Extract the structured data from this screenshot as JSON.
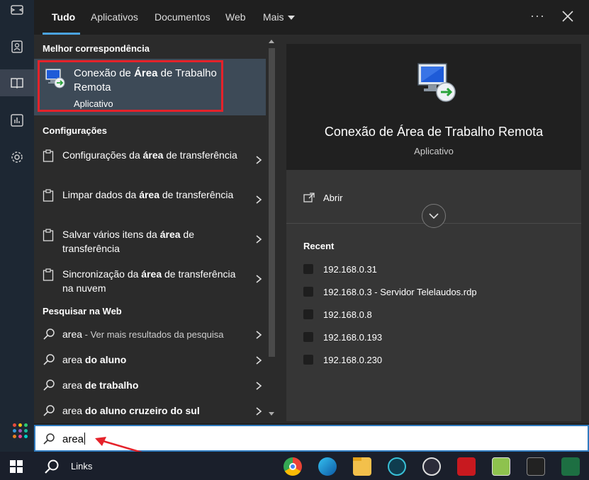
{
  "tabs": [
    {
      "label": "Tudo",
      "active": true
    },
    {
      "label": "Aplicativos"
    },
    {
      "label": "Documentos"
    },
    {
      "label": "Web"
    },
    {
      "label": "Mais"
    }
  ],
  "top_actions": {
    "more": "···"
  },
  "sections": {
    "best_match": "Melhor correspondência",
    "settings": "Configurações",
    "web_search": "Pesquisar na Web"
  },
  "best_match": {
    "title_pre": "Conexão de ",
    "title_bold": "Área",
    "title_post": " de Trabalho Remota",
    "subtitle": "Aplicativo"
  },
  "settings_items": [
    {
      "pre": "Configurações da ",
      "bold": "área",
      "post": " de transferência"
    },
    {
      "pre": "Limpar dados da ",
      "bold": "área",
      "post": " de transferência"
    },
    {
      "pre": "Salvar vários itens da ",
      "bold": "área",
      "post": " de transferência"
    },
    {
      "pre": "Sincronização da ",
      "bold": "área",
      "post": " de transferência na nuvem"
    }
  ],
  "web_items": [
    {
      "query": "area",
      "suffix_bold": "",
      "hint": " - Ver mais resultados da pesquisa"
    },
    {
      "query": "area",
      "suffix_bold": " do aluno",
      "hint": ""
    },
    {
      "query": "area",
      "suffix_bold": " de trabalho",
      "hint": ""
    },
    {
      "query": "area",
      "suffix_bold": " do aluno cruzeiro do sul",
      "hint": ""
    }
  ],
  "preview": {
    "title": "Conexão de Área de Trabalho Remota",
    "subtitle": "Aplicativo",
    "open_label": "Abrir",
    "recent_heading": "Recent",
    "recent": [
      "192.168.0.31",
      "192.168.0.3 - Servidor Telelaudos.rdp",
      "192.168.0.8",
      "192.168.0.193",
      "192.168.0.230"
    ]
  },
  "search": {
    "value": "area"
  },
  "taskbar": {
    "links_label": "Links",
    "apps": [
      "chrome-icon",
      "edge-icon",
      "file-explorer-icon",
      "fingerprint-app-icon",
      "vpn-lock-icon",
      "acrobat-icon",
      "notepad-plus-icon",
      "terminal-app-icon",
      "excel-icon"
    ]
  },
  "colors": {
    "accent": "#4aa3df",
    "highlight_border": "#e5222a",
    "best_bg": "#3d4a57"
  }
}
